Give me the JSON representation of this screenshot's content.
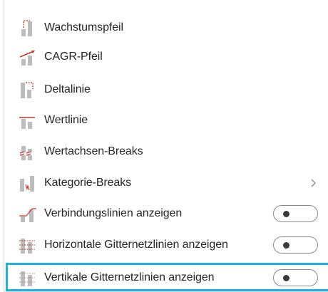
{
  "menu": {
    "items": [
      {
        "label": "Wachstumspfeil",
        "icon": "growth-arrow-icon"
      },
      {
        "label": "CAGR-Pfeil",
        "icon": "cagr-arrow-icon"
      },
      {
        "label": "Deltalinie",
        "icon": "delta-line-icon"
      },
      {
        "label": "Wertlinie",
        "icon": "value-line-icon"
      },
      {
        "label": "Wertachsen-Breaks",
        "icon": "value-axis-break-icon"
      },
      {
        "label": "Kategorie-Breaks",
        "icon": "category-break-icon",
        "submenu": true
      },
      {
        "label": "Verbindungslinien anzeigen",
        "icon": "connector-lines-icon",
        "toggle": "off"
      },
      {
        "label": "Horizontale Gitternetzlinien anzeigen",
        "icon": "horizontal-gridlines-icon",
        "toggle": "off"
      },
      {
        "label": "Vertikale Gitternetzlinien anzeigen",
        "icon": "vertical-gridlines-icon",
        "toggle": "off",
        "focused": true
      }
    ]
  },
  "colors": {
    "accent_red": "#c0392b",
    "icon_gray": "#b5b5b5",
    "focus_blue": "#20b0e8",
    "text": "#262626"
  }
}
